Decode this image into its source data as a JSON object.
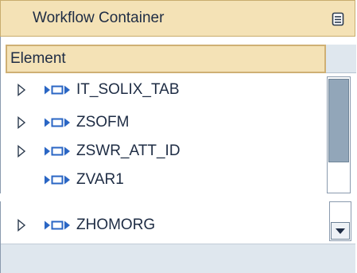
{
  "panel": {
    "title": "Workflow Container",
    "menu_icon": "menu-icon"
  },
  "table": {
    "column_header": "Element",
    "rows": [
      {
        "label": "IT_SOLIX_TAB",
        "expandable": true
      },
      {
        "label": "ZSOFM",
        "expandable": true
      },
      {
        "label": "ZSWR_ATT_ID",
        "expandable": true
      },
      {
        "label": "ZVAR1",
        "expandable": false
      },
      {
        "label": "ZHOMORG",
        "expandable": true
      }
    ]
  },
  "colors": {
    "header_bg": "#f4e2b6",
    "text": "#1e2c44",
    "icon": "#2a66c4",
    "scroll_thumb": "#92a6b9"
  }
}
